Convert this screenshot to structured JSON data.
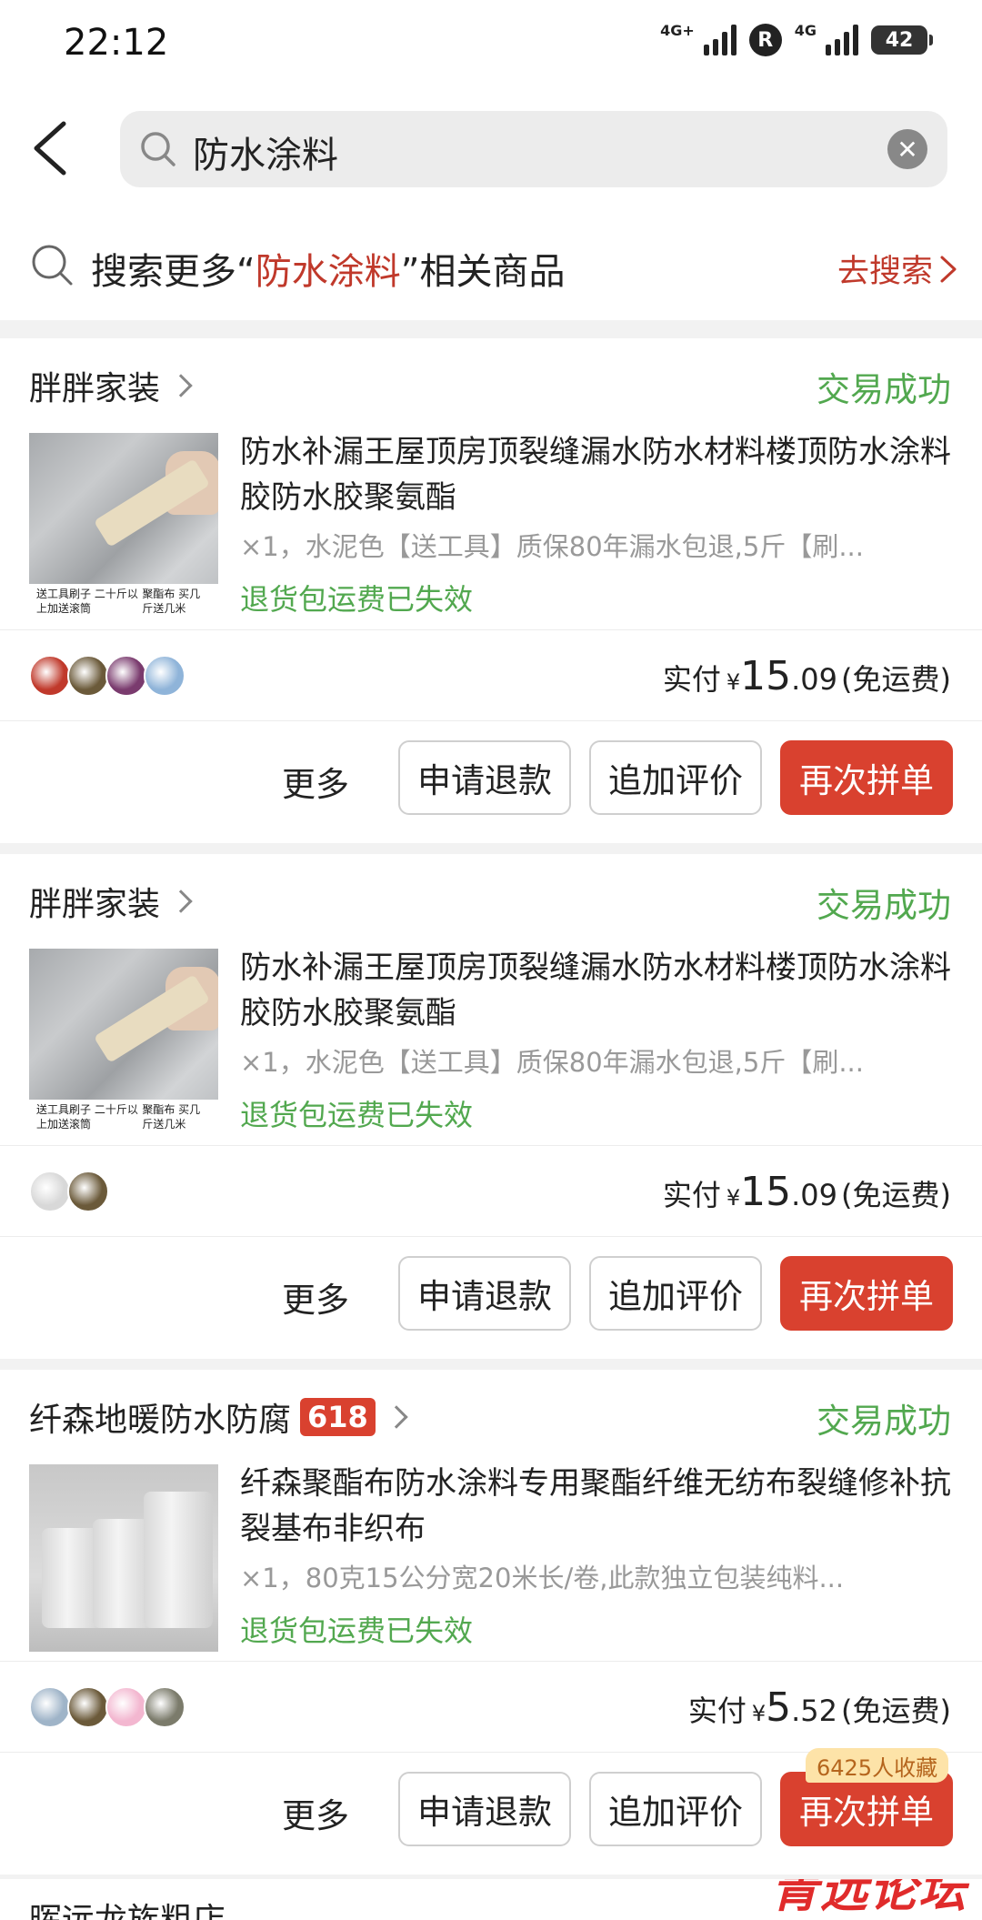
{
  "status_bar": {
    "time": "22:12",
    "network_a": "4G+",
    "network_b": "4G",
    "r_badge": "R",
    "battery": "42"
  },
  "search": {
    "query": "防水涂料",
    "clear_icon": "close-circle-icon",
    "back_icon": "chevron-left-icon",
    "search_icon": "search-icon"
  },
  "search_more": {
    "prefix": "搜索更多“",
    "keyword": "防水涂料",
    "suffix": "”相关商品",
    "action": "去搜索"
  },
  "orders": [
    {
      "store": "胖胖家装",
      "tag": "",
      "status": "交易成功",
      "title": "防水补漏王屋顶房顶裂缝漏水防水材料楼顶防水涂料胶防水胶聚氨酯",
      "spec": "×1，水泥色【送工具】质保80年漏水包退,5斤【刷...",
      "return_note": "退货包运费已失效",
      "thumb_caption_left": "送工具刷子 二十斤以上加送滚筒",
      "thumb_caption_right": "聚酯布 买几斤送几米",
      "pay_label": "实付",
      "currency": "¥",
      "price_int": "15",
      "price_dec": ".09",
      "pay_note": "(免运费)",
      "buyer_count": 4,
      "more": "更多",
      "refund": "申请退款",
      "review": "追加评价",
      "rebuy": "再次拼单",
      "fav_badge": ""
    },
    {
      "store": "胖胖家装",
      "tag": "",
      "status": "交易成功",
      "title": "防水补漏王屋顶房顶裂缝漏水防水材料楼顶防水涂料胶防水胶聚氨酯",
      "spec": "×1，水泥色【送工具】质保80年漏水包退,5斤【刷...",
      "return_note": "退货包运费已失效",
      "thumb_caption_left": "送工具刷子 二十斤以上加送滚筒",
      "thumb_caption_right": "聚酯布 买几斤送几米",
      "pay_label": "实付",
      "currency": "¥",
      "price_int": "15",
      "price_dec": ".09",
      "pay_note": "(免运费)",
      "buyer_count": 2,
      "more": "更多",
      "refund": "申请退款",
      "review": "追加评价",
      "rebuy": "再次拼单",
      "fav_badge": ""
    },
    {
      "store": "纤森地暖防水防腐",
      "tag": "618",
      "status": "交易成功",
      "title": "纤森聚酯布防水涂料专用聚酯纤维无纺布裂缝修补抗裂基布非织布",
      "spec": "×1，80克15公分宽20米长/卷,此款独立包装纯料...",
      "return_note": "退货包运费已失效",
      "thumb_caption_left": "",
      "thumb_caption_right": "",
      "pay_label": "实付",
      "currency": "¥",
      "price_int": "5",
      "price_dec": ".52",
      "pay_note": "(免运费)",
      "buyer_count": 4,
      "more": "更多",
      "refund": "申请退款",
      "review": "追加评价",
      "rebuy": "再次拼单",
      "fav_badge": "6425人收藏"
    }
  ],
  "next_store": {
    "name": "晖远龙族粗店"
  },
  "watermark": "青远论坛",
  "colors": {
    "accent_red": "#d9412f",
    "success_green": "#52a84f",
    "keyword_red": "#c0392b"
  }
}
